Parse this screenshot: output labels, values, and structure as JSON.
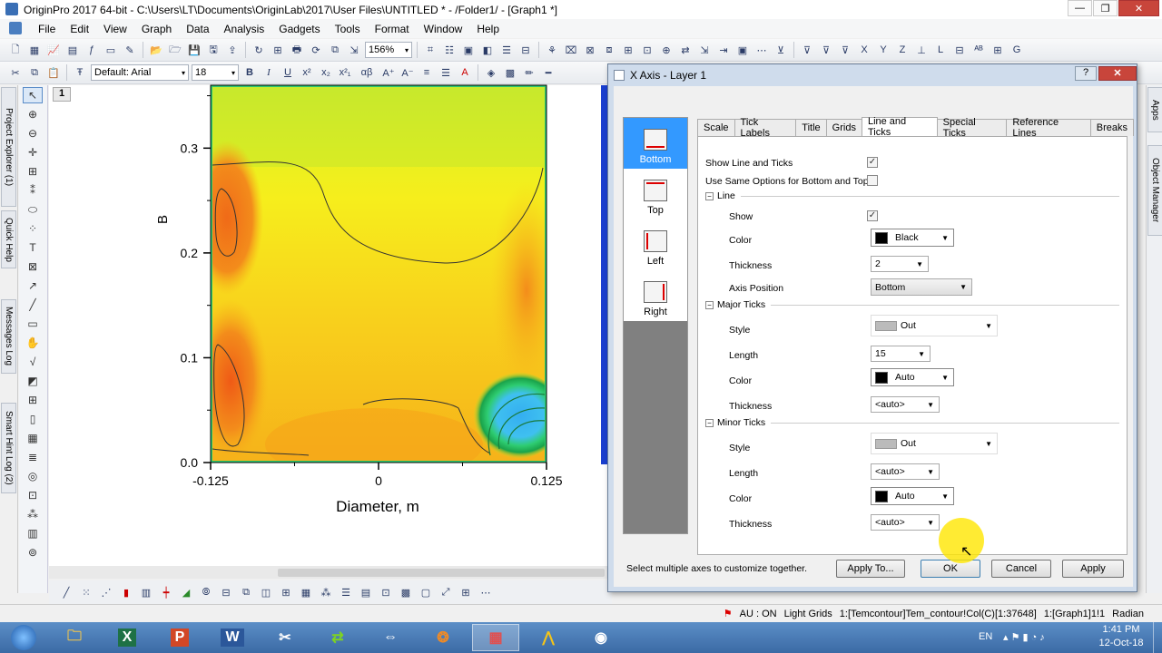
{
  "window": {
    "title": "OriginPro 2017 64-bit - C:\\Users\\LT\\Documents\\OriginLab\\2017\\User Files\\UNTITLED * - /Folder1/ - [Graph1 *]"
  },
  "menu": [
    "File",
    "Edit",
    "View",
    "Graph",
    "Data",
    "Analysis",
    "Gadgets",
    "Tools",
    "Format",
    "Window",
    "Help"
  ],
  "toolbar": {
    "zoom": "156%",
    "font": "Default: Arial",
    "font_size": "18",
    "bold": "B",
    "italic": "I",
    "underline": "U",
    "greek": "αβ"
  },
  "left_panels": [
    "Project Explorer (1)",
    "Quick Help",
    "Messages Log",
    "Smart Hint Log (2)"
  ],
  "right_panels": [
    "Apps",
    "Object Manager"
  ],
  "graph": {
    "layer_label": "1"
  },
  "chart_data": {
    "type": "heatmap",
    "subtype": "contour",
    "title": "",
    "xlabel": "Diameter, m",
    "ylabel": "B",
    "xlim": [
      -0.125,
      0.125
    ],
    "ylim": [
      0.0,
      0.36
    ],
    "x_ticks": [
      "-0.125",
      "0",
      "0.125"
    ],
    "y_ticks": [
      "0.0",
      "0.1",
      "0.2",
      "0.3"
    ],
    "colormap": [
      "#0a55c8",
      "#34b4f0",
      "#2ecc71",
      "#c6e82a",
      "#f4f21c",
      "#f7b319",
      "#f06a18"
    ],
    "regions": [
      {
        "name": "top-band",
        "level": "yellow-green"
      },
      {
        "name": "core",
        "level": "yellow-orange"
      },
      {
        "name": "left-upper-hotspot",
        "level": "orange-red"
      },
      {
        "name": "left-lower-hotspot",
        "level": "orange-red"
      },
      {
        "name": "right-lower-coldspot",
        "level": "blue"
      }
    ]
  },
  "dialog": {
    "title": "X Axis - Layer 1",
    "help": "?",
    "close": "✕",
    "axes": [
      {
        "label": "Bottom",
        "selected": true
      },
      {
        "label": "Top",
        "selected": false
      },
      {
        "label": "Left",
        "selected": false
      },
      {
        "label": "Right",
        "selected": false
      }
    ],
    "tabs": [
      {
        "label": "Scale",
        "active": false
      },
      {
        "label": "Tick Labels",
        "active": false
      },
      {
        "label": "Title",
        "active": false
      },
      {
        "label": "Grids",
        "active": false
      },
      {
        "label": "Line and Ticks",
        "active": true
      },
      {
        "label": "Special Ticks",
        "active": false
      },
      {
        "label": "Reference Lines",
        "active": false
      },
      {
        "label": "Breaks",
        "active": false
      }
    ],
    "show_line_ticks": {
      "label": "Show Line and Ticks",
      "checked": "✓"
    },
    "same_options": {
      "label": "Use Same Options for Bottom and Top",
      "checked": ""
    },
    "line": {
      "group": "Line",
      "show_label": "Show",
      "show_checked": "✓",
      "color_label": "Color",
      "color_value": "Black",
      "color_hex": "#000000",
      "thickness_label": "Thickness",
      "thickness_value": "2",
      "axis_position_label": "Axis Position",
      "axis_position_value": "Bottom"
    },
    "major": {
      "group": "Major Ticks",
      "style_label": "Style",
      "style_value": "Out",
      "length_label": "Length",
      "length_value": "15",
      "color_label": "Color",
      "color_value": "Auto",
      "color_hex": "#000000",
      "thickness_label": "Thickness",
      "thickness_value": "<auto>"
    },
    "minor": {
      "group": "Minor Ticks",
      "style_label": "Style",
      "style_value": "Out",
      "length_label": "Length",
      "length_value": "<auto>",
      "color_label": "Color",
      "color_value": "Auto",
      "color_hex": "#000000",
      "thickness_label": "Thickness",
      "thickness_value": "<auto>"
    },
    "hint": "Select multiple axes to customize together.",
    "buttons": {
      "apply_to": "Apply To...",
      "ok": "OK",
      "cancel": "Cancel",
      "apply": "Apply"
    }
  },
  "status": {
    "au": "AU : ON",
    "grids": "Light Grids",
    "dataset": "1:[Temcontour]Tem_contour!Col(C)[1:37648]",
    "layer": "1:[Graph1]1!1",
    "unit": "Radian"
  },
  "taskbar": {
    "lang": "EN",
    "time": "1:41 PM",
    "date": "12-Oct-18"
  }
}
